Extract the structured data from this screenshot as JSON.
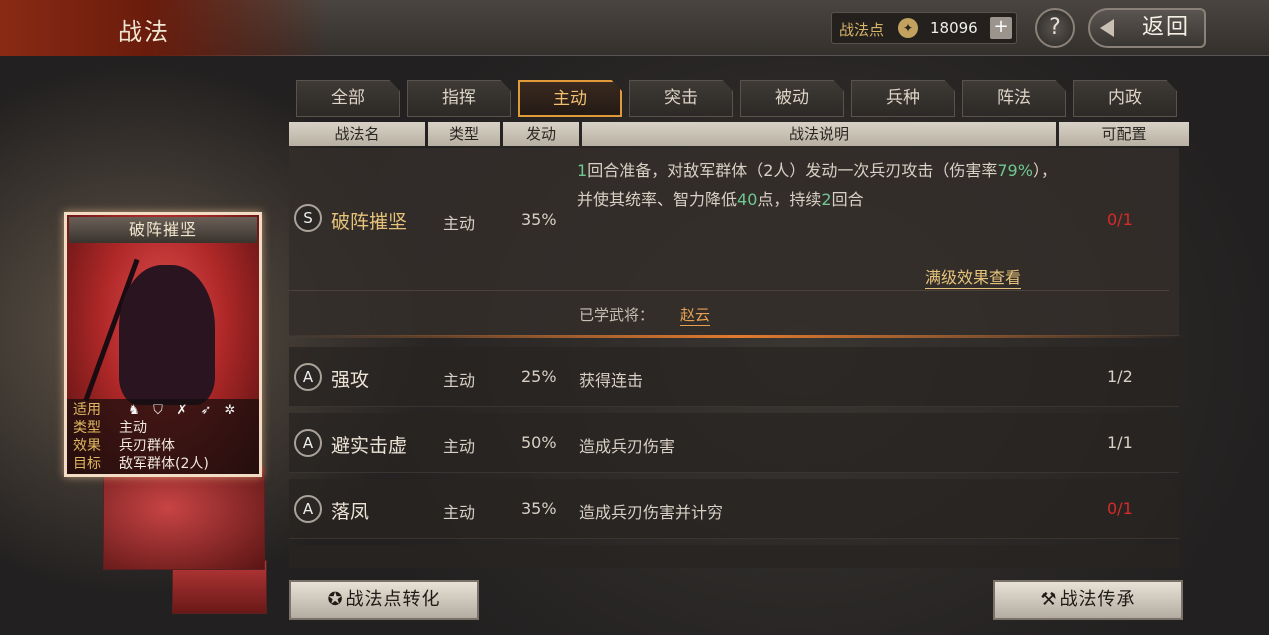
{
  "header": {
    "title": "战法",
    "points_label": "战法点",
    "points_value": "18096",
    "plus": "+",
    "help": "?",
    "back": "返回"
  },
  "tabs": [
    {
      "label": "全部"
    },
    {
      "label": "指挥"
    },
    {
      "label": "主动",
      "active": true
    },
    {
      "label": "突击"
    },
    {
      "label": "被动"
    },
    {
      "label": "兵种"
    },
    {
      "label": "阵法"
    },
    {
      "label": "内政"
    }
  ],
  "columns": {
    "name": "战法名",
    "type": "类型",
    "trigger": "发动",
    "desc": "战法说明",
    "config": "可配置"
  },
  "rows": [
    {
      "grade": "S",
      "name": "破阵摧坚",
      "type": "主动",
      "trigger": "35%",
      "desc_parts": [
        "1",
        "回合准备，对敌军群体（2人）发动一次兵刃攻击（伤害率",
        "79%",
        "），并使其统率、智力降低",
        "40",
        "点，持续",
        "2",
        "回合"
      ],
      "config": "0/1",
      "config_full": false,
      "link": "满级效果查看",
      "learned_label": "已学武将：",
      "learned_value": "赵云"
    },
    {
      "grade": "A",
      "name": "强攻",
      "type": "主动",
      "trigger": "25%",
      "desc": "获得连击",
      "config": "1/2",
      "config_full": true
    },
    {
      "grade": "A",
      "name": "避实击虚",
      "type": "主动",
      "trigger": "50%",
      "desc": "造成兵刃伤害",
      "config": "1/1",
      "config_full": true
    },
    {
      "grade": "A",
      "name": "落凤",
      "type": "主动",
      "trigger": "35%",
      "desc": "造成兵刃伤害并计穷",
      "config": "0/1",
      "config_full": false
    }
  ],
  "card": {
    "title": "破阵摧坚",
    "fit_label": "适用",
    "type_label": "类型",
    "type_value": "主动",
    "effect_label": "效果",
    "effect_value": "兵刃群体",
    "target_label": "目标",
    "target_value": "敌军群体(2人)",
    "troop_icons": [
      "cavalry-icon",
      "shield-icon",
      "bow-icon",
      "spear-icon",
      "wheel-icon"
    ]
  },
  "buttons": {
    "convert": "战法点转化",
    "inherit": "战法传承"
  },
  "colors": {
    "accent_tab": "#e09a3a",
    "highlight_num": "#6ec890",
    "config_unavailable": "#d82a2a",
    "gold_text": "#e6c27a"
  }
}
